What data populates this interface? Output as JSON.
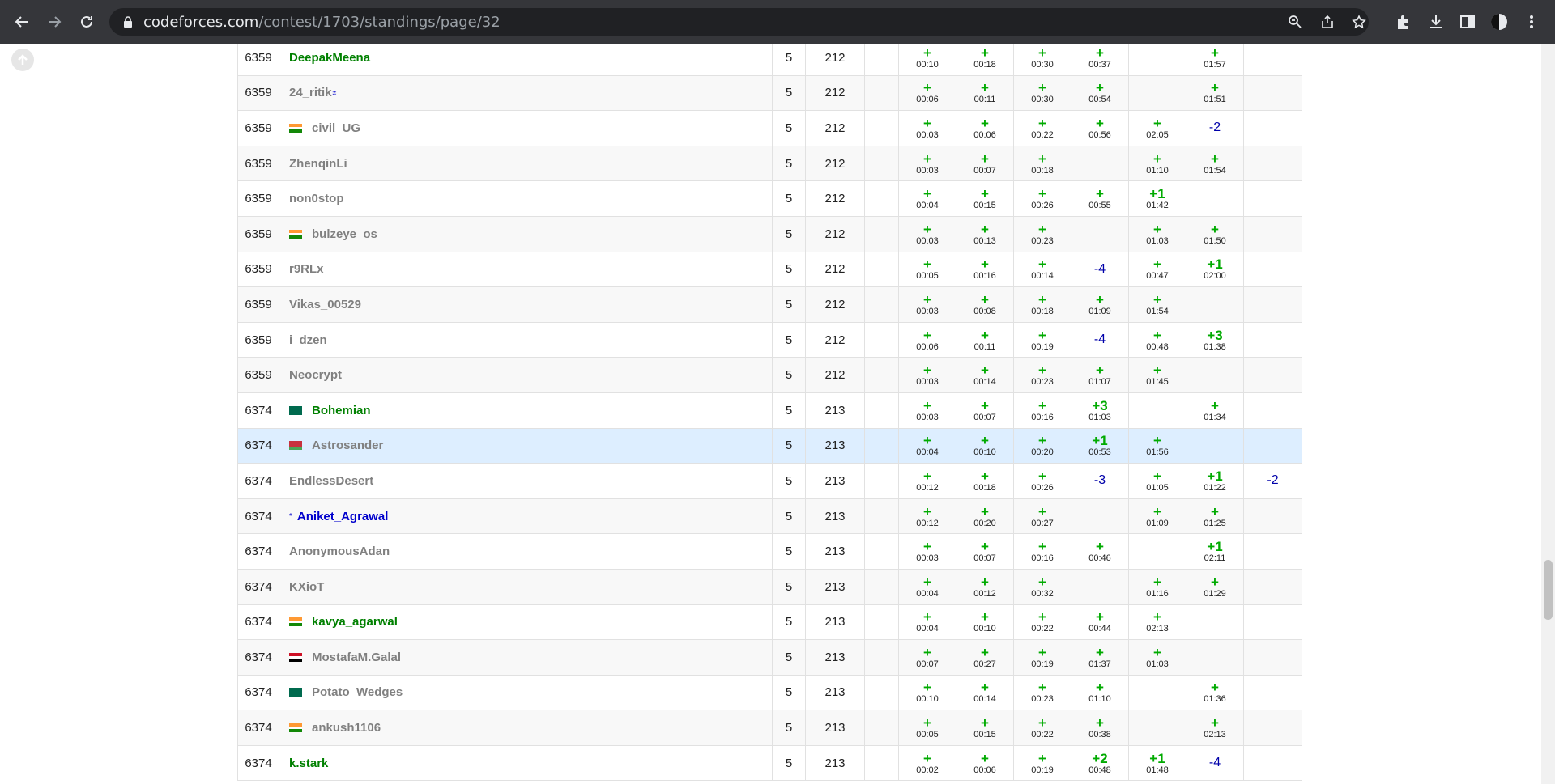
{
  "browser": {
    "url_host": "codeforces.com",
    "url_path": "/contest/1703/standings/page/32"
  },
  "rows": [
    {
      "rank": "6359",
      "handle": "DeepakMeena",
      "color": "green",
      "flag": "",
      "badge": "",
      "solved": "5",
      "penalty": "212",
      "cells": [
        [
          "+",
          "00:10"
        ],
        [
          "+",
          "00:18"
        ],
        [
          "+",
          "00:30"
        ],
        [
          "+",
          "00:37"
        ],
        [
          "",
          ""
        ],
        [
          "+",
          "01:57"
        ],
        [
          "",
          ""
        ]
      ]
    },
    {
      "rank": "6359",
      "handle": "24_ritik",
      "color": "gray",
      "flag": "",
      "badge": "≠",
      "solved": "5",
      "penalty": "212",
      "cells": [
        [
          "+",
          "00:06"
        ],
        [
          "+",
          "00:11"
        ],
        [
          "+",
          "00:30"
        ],
        [
          "+",
          "00:54"
        ],
        [
          "",
          ""
        ],
        [
          "+",
          "01:51"
        ],
        [
          "",
          ""
        ]
      ]
    },
    {
      "rank": "6359",
      "handle": "civil_UG",
      "color": "gray",
      "flag": "in",
      "badge": "",
      "solved": "5",
      "penalty": "212",
      "cells": [
        [
          "+",
          "00:03"
        ],
        [
          "+",
          "00:06"
        ],
        [
          "+",
          "00:22"
        ],
        [
          "+",
          "00:56"
        ],
        [
          "+",
          "02:05"
        ],
        [
          "-2",
          ""
        ],
        [
          "",
          ""
        ]
      ]
    },
    {
      "rank": "6359",
      "handle": "ZhenqinLi",
      "color": "gray",
      "flag": "",
      "badge": "",
      "solved": "5",
      "penalty": "212",
      "cells": [
        [
          "+",
          "00:03"
        ],
        [
          "+",
          "00:07"
        ],
        [
          "+",
          "00:18"
        ],
        [
          "",
          ""
        ],
        [
          "+",
          "01:10"
        ],
        [
          "+",
          "01:54"
        ],
        [
          "",
          ""
        ]
      ]
    },
    {
      "rank": "6359",
      "handle": "non0stop",
      "color": "gray",
      "flag": "",
      "badge": "",
      "solved": "5",
      "penalty": "212",
      "cells": [
        [
          "+",
          "00:04"
        ],
        [
          "+",
          "00:15"
        ],
        [
          "+",
          "00:26"
        ],
        [
          "+",
          "00:55"
        ],
        [
          "+1",
          "01:42"
        ],
        [
          "",
          ""
        ],
        [
          "",
          ""
        ]
      ]
    },
    {
      "rank": "6359",
      "handle": "bulzeye_os",
      "color": "gray",
      "flag": "in",
      "badge": "",
      "solved": "5",
      "penalty": "212",
      "cells": [
        [
          "+",
          "00:03"
        ],
        [
          "+",
          "00:13"
        ],
        [
          "+",
          "00:23"
        ],
        [
          "",
          ""
        ],
        [
          "+",
          "01:03"
        ],
        [
          "+",
          "01:50"
        ],
        [
          "",
          ""
        ]
      ]
    },
    {
      "rank": "6359",
      "handle": "r9RLx",
      "color": "gray",
      "flag": "",
      "badge": "",
      "solved": "5",
      "penalty": "212",
      "cells": [
        [
          "+",
          "00:05"
        ],
        [
          "+",
          "00:16"
        ],
        [
          "+",
          "00:14"
        ],
        [
          "-4",
          ""
        ],
        [
          "+",
          "00:47"
        ],
        [
          "+1",
          "02:00"
        ],
        [
          "",
          ""
        ]
      ]
    },
    {
      "rank": "6359",
      "handle": "Vikas_00529",
      "color": "gray",
      "flag": "",
      "badge": "",
      "solved": "5",
      "penalty": "212",
      "cells": [
        [
          "+",
          "00:03"
        ],
        [
          "+",
          "00:08"
        ],
        [
          "+",
          "00:18"
        ],
        [
          "+",
          "01:09"
        ],
        [
          "+",
          "01:54"
        ],
        [
          "",
          ""
        ],
        [
          "",
          ""
        ]
      ]
    },
    {
      "rank": "6359",
      "handle": "i_dzen",
      "color": "gray",
      "flag": "",
      "badge": "",
      "solved": "5",
      "penalty": "212",
      "cells": [
        [
          "+",
          "00:06"
        ],
        [
          "+",
          "00:11"
        ],
        [
          "+",
          "00:19"
        ],
        [
          "-4",
          ""
        ],
        [
          "+",
          "00:48"
        ],
        [
          "+3",
          "01:38"
        ],
        [
          "",
          ""
        ]
      ]
    },
    {
      "rank": "6359",
      "handle": "Neocrypt",
      "color": "gray",
      "flag": "",
      "badge": "",
      "solved": "5",
      "penalty": "212",
      "cells": [
        [
          "+",
          "00:03"
        ],
        [
          "+",
          "00:14"
        ],
        [
          "+",
          "00:23"
        ],
        [
          "+",
          "01:07"
        ],
        [
          "+",
          "01:45"
        ],
        [
          "",
          ""
        ],
        [
          "",
          ""
        ]
      ]
    },
    {
      "rank": "6374",
      "handle": "Bohemian",
      "color": "green",
      "flag": "bd",
      "badge": "",
      "solved": "5",
      "penalty": "213",
      "cells": [
        [
          "+",
          "00:03"
        ],
        [
          "+",
          "00:07"
        ],
        [
          "+",
          "00:16"
        ],
        [
          "+3",
          "01:03"
        ],
        [
          "",
          ""
        ],
        [
          "+",
          "01:34"
        ],
        [
          "",
          ""
        ]
      ]
    },
    {
      "rank": "6374",
      "handle": "Astrosander",
      "color": "gray",
      "flag": "by",
      "badge": "",
      "solved": "5",
      "penalty": "213",
      "cells": [
        [
          "+",
          "00:04"
        ],
        [
          "+",
          "00:10"
        ],
        [
          "+",
          "00:20"
        ],
        [
          "+1",
          "00:53"
        ],
        [
          "+",
          "01:56"
        ],
        [
          "",
          ""
        ],
        [
          "",
          ""
        ]
      ],
      "highlight": true
    },
    {
      "rank": "6374",
      "handle": "EndlessDesert",
      "color": "gray",
      "flag": "",
      "badge": "",
      "solved": "5",
      "penalty": "213",
      "cells": [
        [
          "+",
          "00:12"
        ],
        [
          "+",
          "00:18"
        ],
        [
          "+",
          "00:26"
        ],
        [
          "-3",
          ""
        ],
        [
          "+",
          "01:05"
        ],
        [
          "+1",
          "01:22"
        ],
        [
          "-2",
          ""
        ]
      ]
    },
    {
      "rank": "6374",
      "handle": "Aniket_Agrawal",
      "color": "blue",
      "flag": "",
      "badge": "",
      "star": "*",
      "solved": "5",
      "penalty": "213",
      "cells": [
        [
          "+",
          "00:12"
        ],
        [
          "+",
          "00:20"
        ],
        [
          "+",
          "00:27"
        ],
        [
          "",
          ""
        ],
        [
          "+",
          "01:09"
        ],
        [
          "+",
          "01:25"
        ],
        [
          "",
          ""
        ]
      ]
    },
    {
      "rank": "6374",
      "handle": "AnonymousAdan",
      "color": "gray",
      "flag": "",
      "badge": "",
      "solved": "5",
      "penalty": "213",
      "cells": [
        [
          "+",
          "00:03"
        ],
        [
          "+",
          "00:07"
        ],
        [
          "+",
          "00:16"
        ],
        [
          "+",
          "00:46"
        ],
        [
          "",
          ""
        ],
        [
          "+1",
          "02:11"
        ],
        [
          "",
          ""
        ]
      ]
    },
    {
      "rank": "6374",
      "handle": "KXioT",
      "color": "gray",
      "flag": "",
      "badge": "",
      "solved": "5",
      "penalty": "213",
      "cells": [
        [
          "+",
          "00:04"
        ],
        [
          "+",
          "00:12"
        ],
        [
          "+",
          "00:32"
        ],
        [
          "",
          ""
        ],
        [
          "+",
          "01:16"
        ],
        [
          "+",
          "01:29"
        ],
        [
          "",
          ""
        ]
      ]
    },
    {
      "rank": "6374",
      "handle": "kavya_agarwal",
      "color": "green",
      "flag": "in",
      "badge": "",
      "solved": "5",
      "penalty": "213",
      "cells": [
        [
          "+",
          "00:04"
        ],
        [
          "+",
          "00:10"
        ],
        [
          "+",
          "00:22"
        ],
        [
          "+",
          "00:44"
        ],
        [
          "+",
          "02:13"
        ],
        [
          "",
          ""
        ],
        [
          "",
          ""
        ]
      ]
    },
    {
      "rank": "6374",
      "handle": "MostafaM.Galal",
      "color": "gray",
      "flag": "eg",
      "badge": "",
      "solved": "5",
      "penalty": "213",
      "cells": [
        [
          "+",
          "00:07"
        ],
        [
          "+",
          "00:27"
        ],
        [
          "+",
          "00:19"
        ],
        [
          "+",
          "01:37"
        ],
        [
          "+",
          "01:03"
        ],
        [
          "",
          ""
        ],
        [
          "",
          ""
        ]
      ]
    },
    {
      "rank": "6374",
      "handle": "Potato_Wedges",
      "color": "gray",
      "flag": "bd",
      "badge": "",
      "solved": "5",
      "penalty": "213",
      "cells": [
        [
          "+",
          "00:10"
        ],
        [
          "+",
          "00:14"
        ],
        [
          "+",
          "00:23"
        ],
        [
          "+",
          "01:10"
        ],
        [
          "",
          ""
        ],
        [
          "+",
          "01:36"
        ],
        [
          "",
          ""
        ]
      ]
    },
    {
      "rank": "6374",
      "handle": "ankush1106",
      "color": "gray",
      "flag": "in",
      "badge": "",
      "solved": "5",
      "penalty": "213",
      "cells": [
        [
          "+",
          "00:05"
        ],
        [
          "+",
          "00:15"
        ],
        [
          "+",
          "00:22"
        ],
        [
          "+",
          "00:38"
        ],
        [
          "",
          ""
        ],
        [
          "+",
          "02:13"
        ],
        [
          "",
          ""
        ]
      ]
    },
    {
      "rank": "6374",
      "handle": "k.stark",
      "color": "green",
      "flag": "",
      "badge": "",
      "solved": "5",
      "penalty": "213",
      "cells": [
        [
          "+",
          "00:02"
        ],
        [
          "+",
          "00:06"
        ],
        [
          "+",
          "00:19"
        ],
        [
          "+2",
          "00:48"
        ],
        [
          "+1",
          "01:48"
        ],
        [
          "-4",
          ""
        ],
        [
          "",
          ""
        ]
      ]
    }
  ]
}
